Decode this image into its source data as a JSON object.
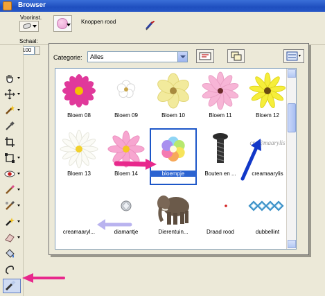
{
  "titlebar": {
    "title": "Browser"
  },
  "options": {
    "presets_label": "Voorinst.",
    "tube_name": "Knoppen rood",
    "scale_label": "Schaal:",
    "scale_value": "100"
  },
  "browser": {
    "category_label": "Categorie:",
    "category_value": "Alles",
    "items": [
      {
        "label": "Bloem 08",
        "icon": "pink-daisy"
      },
      {
        "label": "Bloem 09",
        "icon": "white-flower"
      },
      {
        "label": "Bloem 10",
        "icon": "yellow-flower"
      },
      {
        "label": "Bloem 11",
        "icon": "pink-daisy-large"
      },
      {
        "label": "Bloem 12",
        "icon": "yellow-daisy"
      },
      {
        "label": "Bloem 13",
        "icon": "white-daisy"
      },
      {
        "label": "Bloem 14",
        "icon": "pink-flower"
      },
      {
        "label": "bloempje",
        "icon": "rainbow-flower",
        "selected": true
      },
      {
        "label": "Bouten en ...",
        "icon": "bolt"
      },
      {
        "label": "creamaarylis",
        "icon": "text-creamaarylis"
      },
      {
        "label": "creamaaryl...",
        "icon": "blank"
      },
      {
        "label": "diamantje",
        "icon": "diamond"
      },
      {
        "label": "Dierentuin...",
        "icon": "elephant"
      },
      {
        "label": "Draad rood",
        "icon": "red-dot"
      },
      {
        "label": "dubbellint",
        "icon": "ribbon-chain"
      }
    ],
    "watermark_text": "cre@maarylis"
  },
  "colors": {
    "selection": "#2b63d1",
    "annotation_pink": "#e8288c",
    "annotation_blue": "#1238c8",
    "annotation_lavender": "#b9b3ef"
  }
}
